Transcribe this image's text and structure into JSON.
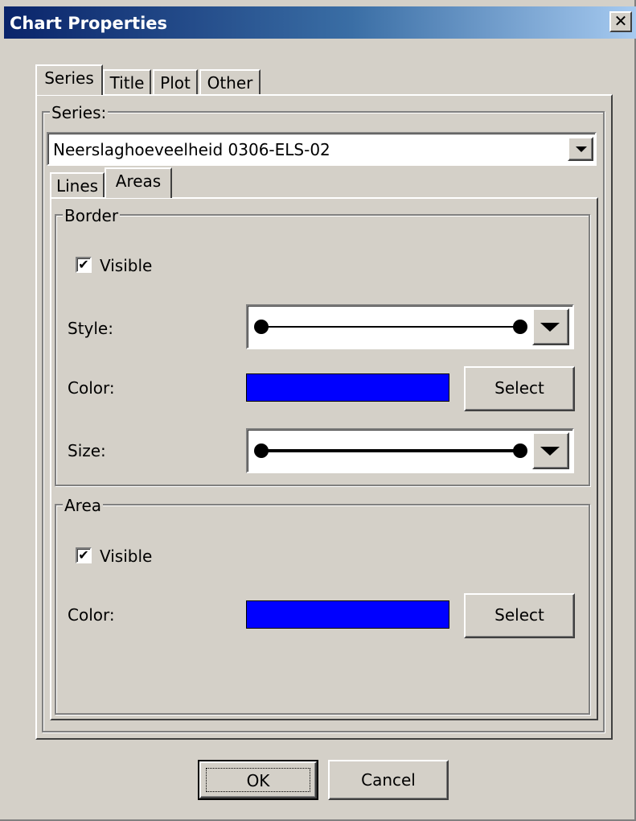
{
  "window": {
    "title": "Chart Properties",
    "close_glyph": "✕"
  },
  "tabs": [
    {
      "label": "Series"
    },
    {
      "label": "Title"
    },
    {
      "label": "Plot"
    },
    {
      "label": "Other"
    }
  ],
  "series_group": {
    "legend": "Series:",
    "selected_series": "Neerslaghoeveelheid 0306-ELS-02"
  },
  "subtabs": [
    {
      "label": "Lines"
    },
    {
      "label": "Areas"
    }
  ],
  "border_group": {
    "legend": "Border",
    "visible_label": "Visible",
    "visible_checked": true,
    "style_label": "Style:",
    "color_label": "Color:",
    "color_value": "#0000ff",
    "select_label": "Select",
    "size_label": "Size:"
  },
  "area_group": {
    "legend": "Area",
    "visible_label": "Visible",
    "visible_checked": true,
    "color_label": "Color:",
    "color_value": "#0000ff",
    "select_label": "Select"
  },
  "footer": {
    "ok_label": "OK",
    "cancel_label": "Cancel"
  },
  "icons": {
    "checkmark": "✔",
    "dropdown_arrow": "chevron-down-icon",
    "close": "close-icon"
  }
}
